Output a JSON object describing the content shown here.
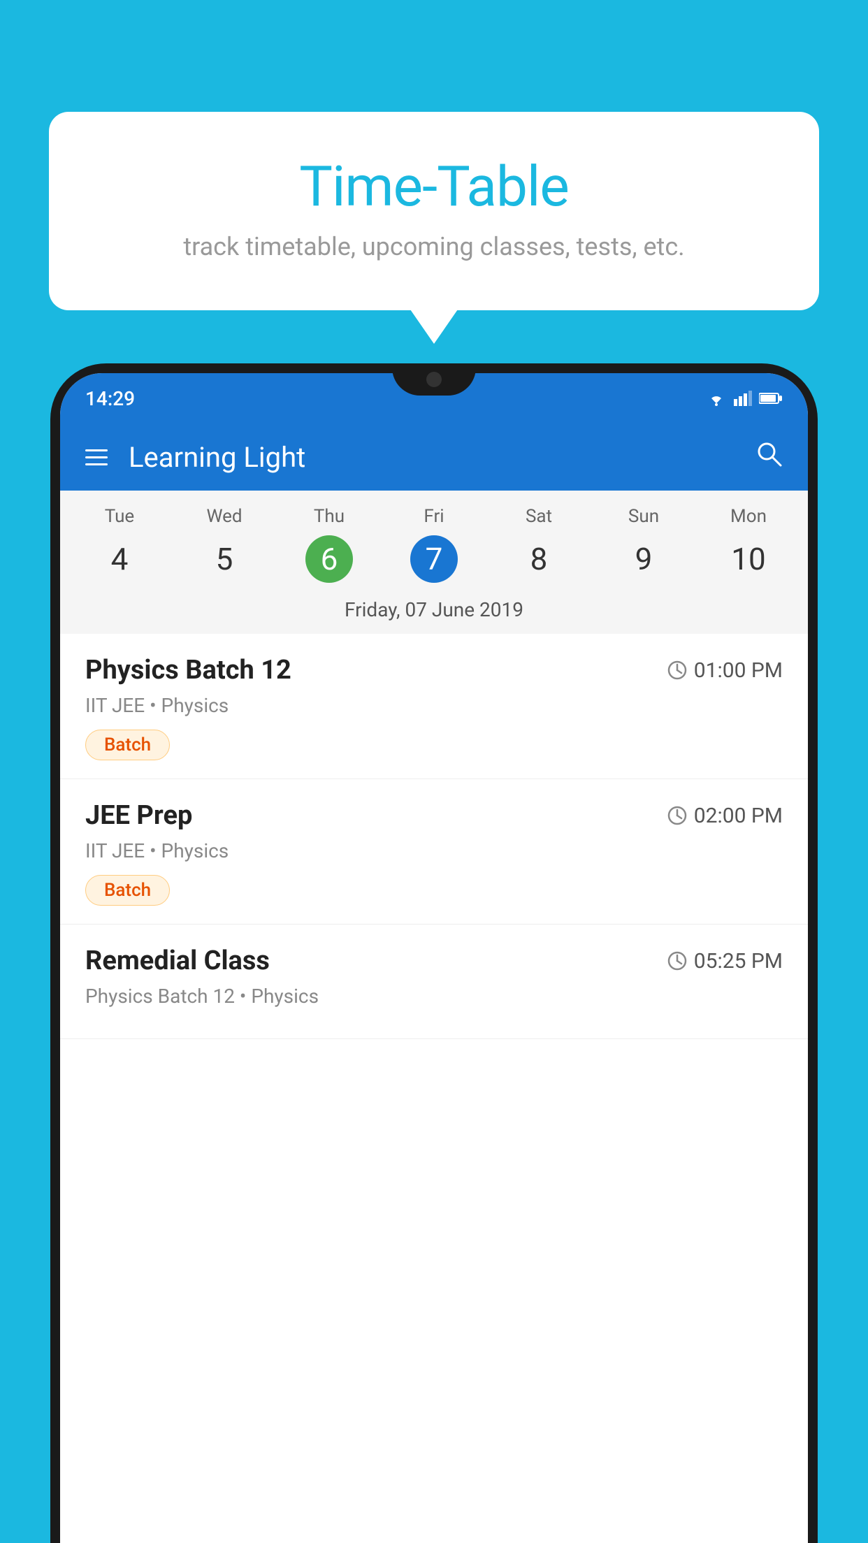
{
  "background_color": "#1BB8E0",
  "tooltip": {
    "title": "Time-Table",
    "subtitle": "track timetable, upcoming classes, tests, etc."
  },
  "app": {
    "title": "Learning Light",
    "status_time": "14:29"
  },
  "calendar": {
    "days": [
      {
        "name": "Tue",
        "number": "4",
        "state": "normal"
      },
      {
        "name": "Wed",
        "number": "5",
        "state": "normal"
      },
      {
        "name": "Thu",
        "number": "6",
        "state": "today"
      },
      {
        "name": "Fri",
        "number": "7",
        "state": "selected"
      },
      {
        "name": "Sat",
        "number": "8",
        "state": "normal"
      },
      {
        "name": "Sun",
        "number": "9",
        "state": "normal"
      },
      {
        "name": "Mon",
        "number": "10",
        "state": "normal"
      }
    ],
    "selected_date_label": "Friday, 07 June 2019"
  },
  "schedule": [
    {
      "name": "Physics Batch 12",
      "time": "01:00 PM",
      "info": "IIT JEE • Physics",
      "badge": "Batch"
    },
    {
      "name": "JEE Prep",
      "time": "02:00 PM",
      "info": "IIT JEE • Physics",
      "badge": "Batch"
    },
    {
      "name": "Remedial Class",
      "time": "05:25 PM",
      "info": "Physics Batch 12 • Physics",
      "badge": null
    }
  ],
  "buttons": {
    "hamburger_label": "menu",
    "search_label": "search"
  }
}
